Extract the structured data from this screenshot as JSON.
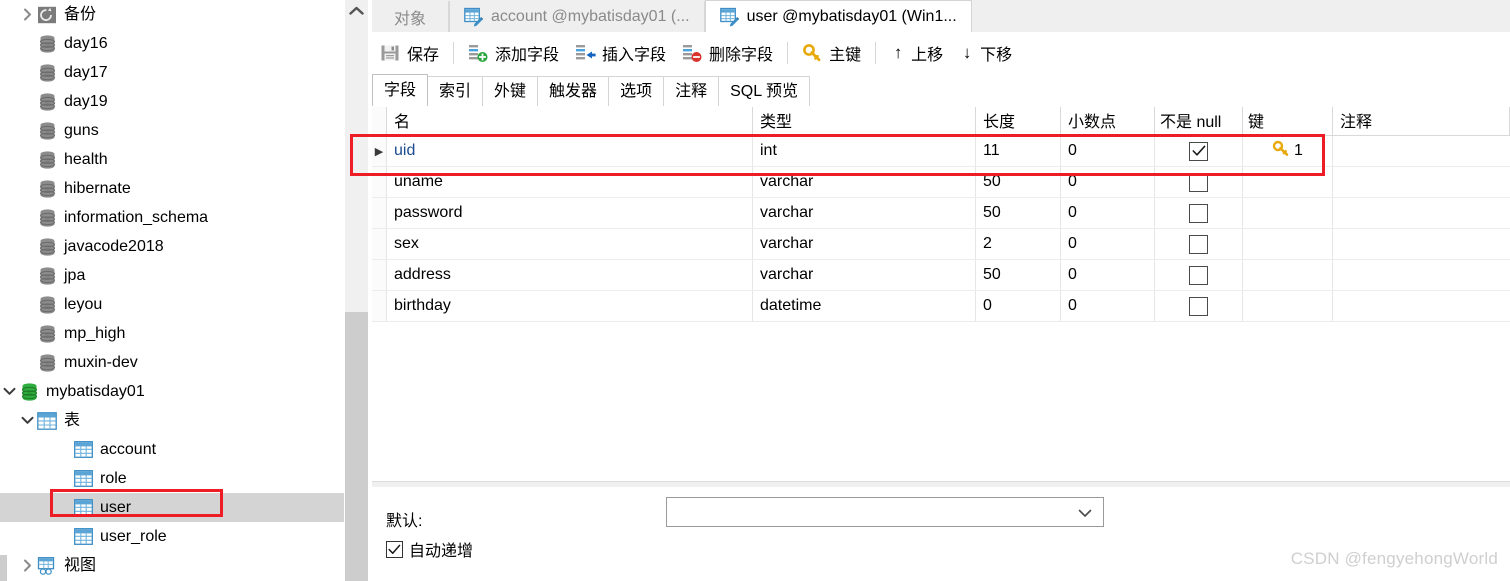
{
  "sidebar": {
    "items": [
      {
        "label": "备份",
        "icon": "backup-icon",
        "indent": 1,
        "twisty": "collapsed",
        "selected": false
      },
      {
        "label": "day16",
        "icon": "database-icon",
        "indent": 1,
        "twisty": "none",
        "selected": false
      },
      {
        "label": "day17",
        "icon": "database-icon",
        "indent": 1,
        "twisty": "none",
        "selected": false
      },
      {
        "label": "day19",
        "icon": "database-icon",
        "indent": 1,
        "twisty": "none",
        "selected": false
      },
      {
        "label": "guns",
        "icon": "database-icon",
        "indent": 1,
        "twisty": "none",
        "selected": false
      },
      {
        "label": "health",
        "icon": "database-icon",
        "indent": 1,
        "twisty": "none",
        "selected": false
      },
      {
        "label": "hibernate",
        "icon": "database-icon",
        "indent": 1,
        "twisty": "none",
        "selected": false
      },
      {
        "label": "information_schema",
        "icon": "database-icon",
        "indent": 1,
        "twisty": "none",
        "selected": false
      },
      {
        "label": "javacode2018",
        "icon": "database-icon",
        "indent": 1,
        "twisty": "none",
        "selected": false
      },
      {
        "label": "jpa",
        "icon": "database-icon",
        "indent": 1,
        "twisty": "none",
        "selected": false
      },
      {
        "label": "leyou",
        "icon": "database-icon",
        "indent": 1,
        "twisty": "none",
        "selected": false
      },
      {
        "label": "mp_high",
        "icon": "database-icon",
        "indent": 1,
        "twisty": "none",
        "selected": false
      },
      {
        "label": "muxin-dev",
        "icon": "database-icon",
        "indent": 1,
        "twisty": "none",
        "selected": false
      },
      {
        "label": "mybatisday01",
        "icon": "database-open-icon",
        "indent": 0,
        "twisty": "expanded",
        "selected": false
      },
      {
        "label": "表",
        "icon": "table-folder-icon",
        "indent": 1,
        "twisty": "expanded",
        "selected": false
      },
      {
        "label": "account",
        "icon": "table-icon",
        "indent": 3,
        "twisty": "none",
        "selected": false
      },
      {
        "label": "role",
        "icon": "table-icon",
        "indent": 3,
        "twisty": "none",
        "selected": false
      },
      {
        "label": "user",
        "icon": "table-icon",
        "indent": 3,
        "twisty": "none",
        "selected": true
      },
      {
        "label": "user_role",
        "icon": "table-icon",
        "indent": 3,
        "twisty": "none",
        "selected": false
      },
      {
        "label": "视图",
        "icon": "view-icon",
        "indent": 1,
        "twisty": "collapsed",
        "selected": false
      }
    ]
  },
  "tabs": {
    "object_label": "对象",
    "items": [
      {
        "label": "account @mybatisday01 (...",
        "icon": "table-design-icon",
        "active": false
      },
      {
        "label": "user @mybatisday01 (Win1...",
        "icon": "table-design-icon",
        "active": true
      }
    ]
  },
  "toolbar": {
    "save": "保存",
    "add_field": "添加字段",
    "insert_field": "插入字段",
    "delete_field": "删除字段",
    "primary_key": "主键",
    "move_up": "上移",
    "move_down": "下移",
    "up_glyph": "↑",
    "down_glyph": "↓"
  },
  "subtabs": [
    {
      "label": "字段",
      "active": true
    },
    {
      "label": "索引",
      "active": false
    },
    {
      "label": "外键",
      "active": false
    },
    {
      "label": "触发器",
      "active": false
    },
    {
      "label": "选项",
      "active": false
    },
    {
      "label": "注释",
      "active": false
    },
    {
      "label": "SQL 预览",
      "active": false
    }
  ],
  "grid": {
    "columns": [
      "名",
      "类型",
      "长度",
      "小数点",
      "不是 null",
      "键",
      "注释"
    ],
    "rows": [
      {
        "name": "uid",
        "type": "int",
        "length": "11",
        "decimals": "0",
        "not_null": true,
        "key": "1",
        "comment": "",
        "selected": true
      },
      {
        "name": "uname",
        "type": "varchar",
        "length": "50",
        "decimals": "0",
        "not_null": false,
        "key": "",
        "comment": "",
        "selected": false
      },
      {
        "name": "password",
        "type": "varchar",
        "length": "50",
        "decimals": "0",
        "not_null": false,
        "key": "",
        "comment": "",
        "selected": false
      },
      {
        "name": "sex",
        "type": "varchar",
        "length": "2",
        "decimals": "0",
        "not_null": false,
        "key": "",
        "comment": "",
        "selected": false
      },
      {
        "name": "address",
        "type": "varchar",
        "length": "50",
        "decimals": "0",
        "not_null": false,
        "key": "",
        "comment": "",
        "selected": false
      },
      {
        "name": "birthday",
        "type": "datetime",
        "length": "0",
        "decimals": "0",
        "not_null": false,
        "key": "",
        "comment": "",
        "selected": false
      }
    ]
  },
  "bottom": {
    "default_label": "默认:",
    "default_value": "",
    "auto_increment_label": "自动递增",
    "auto_increment_checked": true
  },
  "watermark": "CSDN @fengyehongWorld",
  "colors": {
    "accent_red": "#ee1c25",
    "selection_gray": "#d4d4d4",
    "db_green": "#2fad3e",
    "table_blue": "#3c8dc5",
    "key_gold": "#e8a90c"
  }
}
